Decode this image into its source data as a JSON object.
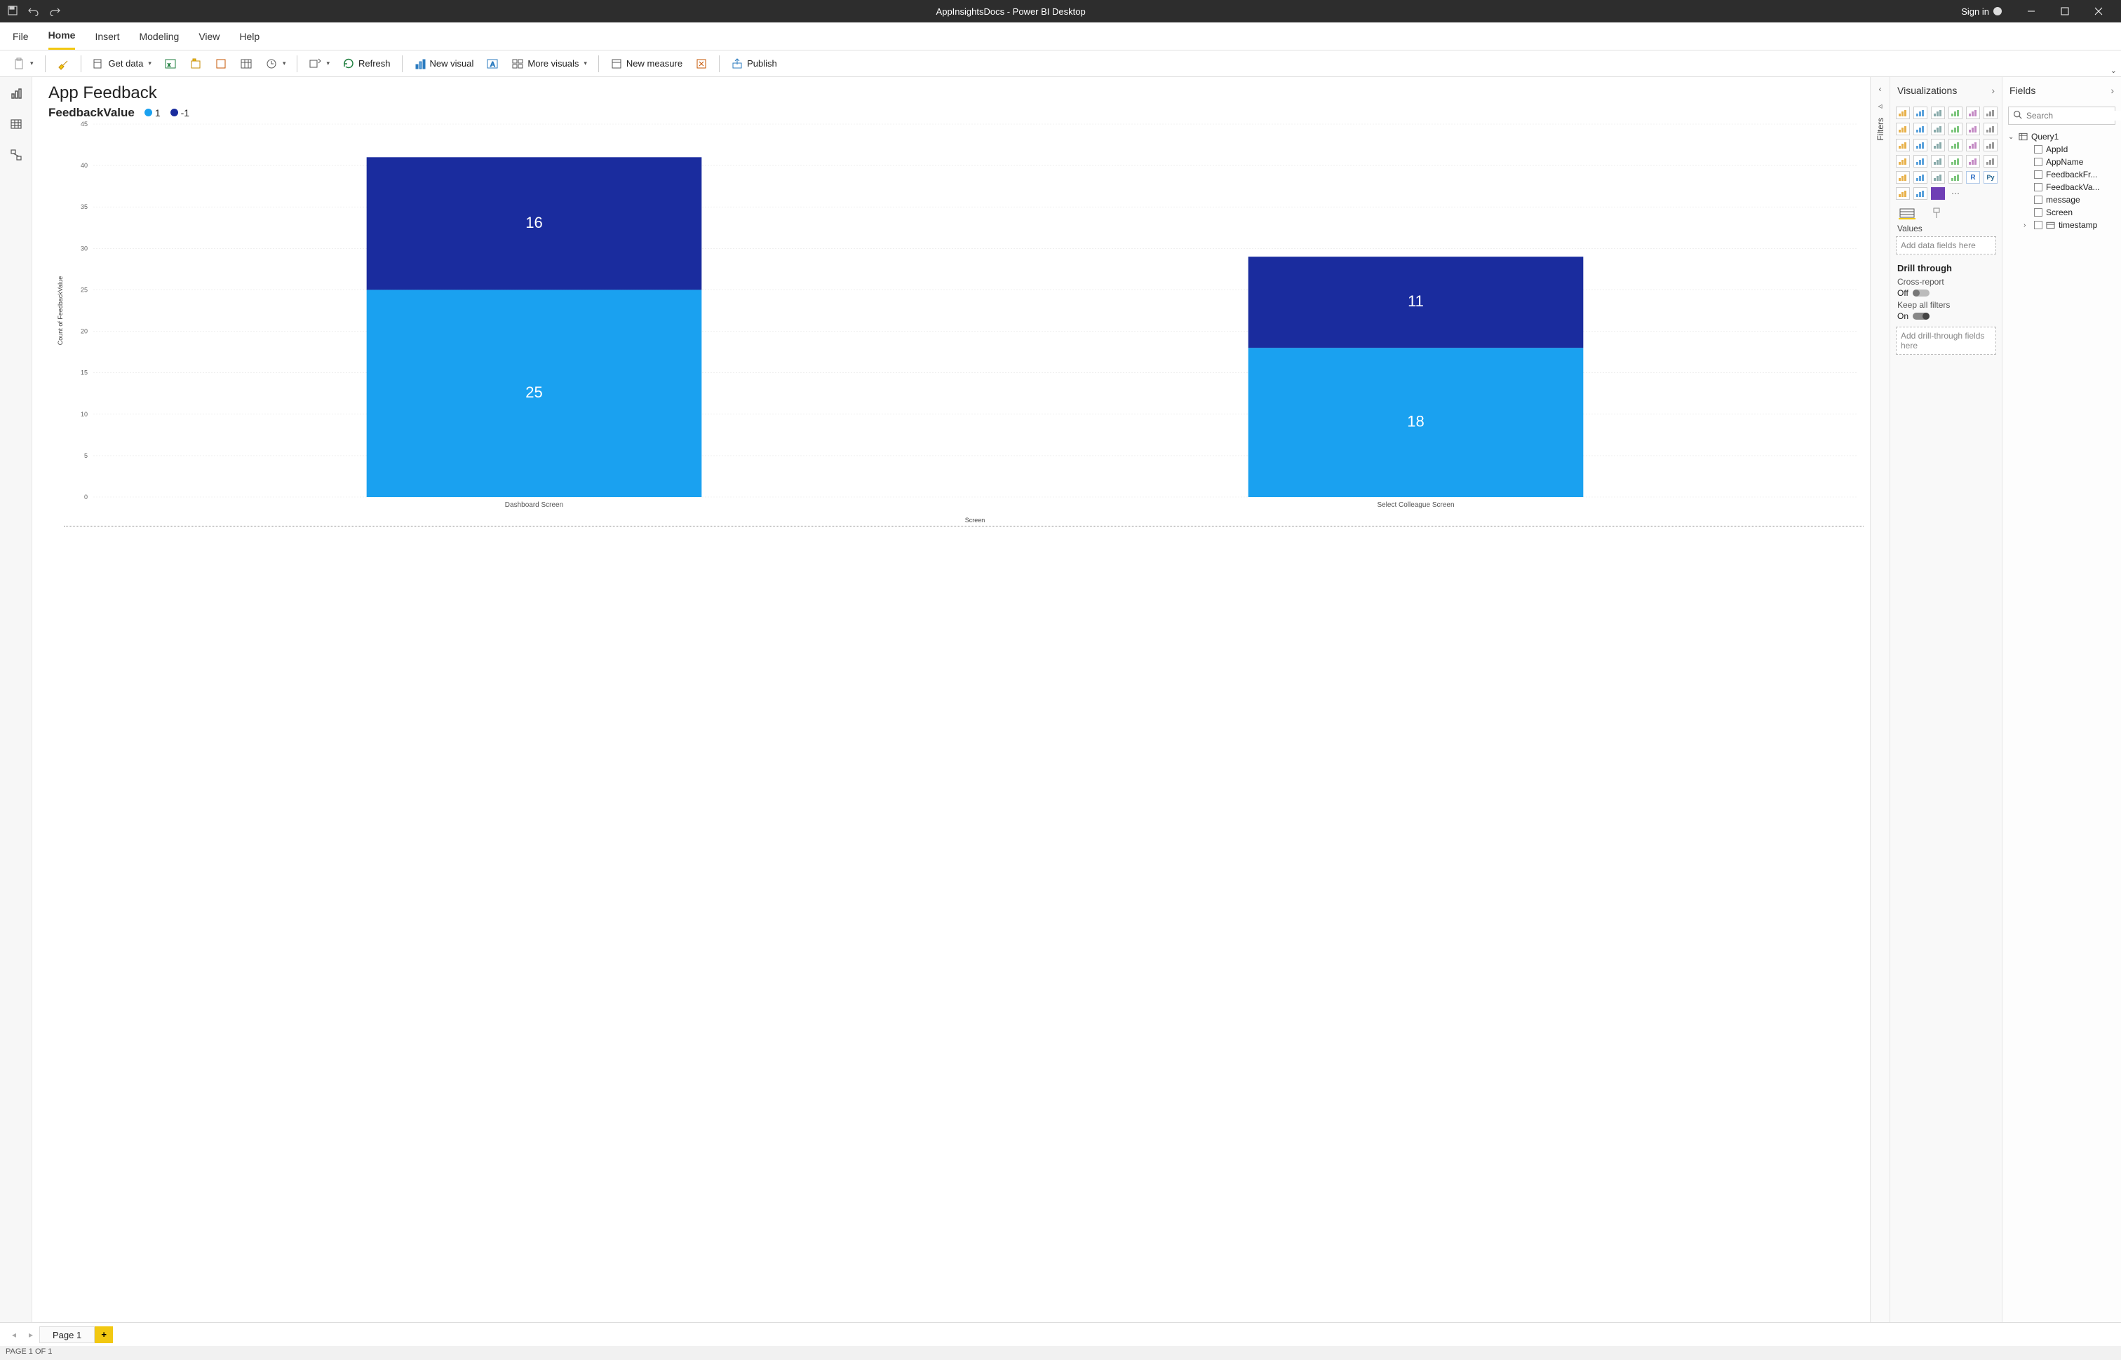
{
  "titlebar": {
    "title": "AppInsightsDocs - Power BI Desktop",
    "sign_in": "Sign in"
  },
  "menu_tabs": [
    "File",
    "Home",
    "Insert",
    "Modeling",
    "View",
    "Help"
  ],
  "menu_active": "Home",
  "ribbon": {
    "get_data": "Get data",
    "refresh": "Refresh",
    "new_visual": "New visual",
    "more_visuals": "More visuals",
    "new_measure": "New measure",
    "publish": "Publish",
    "textbox": "A"
  },
  "report": {
    "title": "App Feedback",
    "legend_series": "FeedbackValue",
    "legend_items": [
      {
        "label": "1",
        "color": "#1aa1f0"
      },
      {
        "label": "-1",
        "color": "#1a2c9e"
      }
    ],
    "y_axis_title": "Count of FeedbackValue",
    "x_axis_title": "Screen"
  },
  "chart_data": {
    "type": "bar",
    "stacked": true,
    "categories": [
      "Dashboard Screen",
      "Select Colleague Screen"
    ],
    "series": [
      {
        "name": "1",
        "color": "#1aa1f0",
        "values": [
          25,
          18
        ]
      },
      {
        "name": "-1",
        "color": "#1a2c9e",
        "values": [
          16,
          11
        ]
      }
    ],
    "xlabel": "Screen",
    "ylabel": "Count of FeedbackValue",
    "ylim": [
      0,
      45
    ],
    "yticks": [
      0,
      5,
      10,
      15,
      20,
      25,
      30,
      35,
      40,
      45
    ]
  },
  "filters": {
    "label": "Filters"
  },
  "viz_pane": {
    "title": "Visualizations",
    "values_label": "Values",
    "values_placeholder": "Add data fields here",
    "drill_header": "Drill through",
    "cross_report": "Cross-report",
    "cross_report_state": "Off",
    "keep_filters": "Keep all filters",
    "keep_filters_state": "On",
    "drill_placeholder": "Add drill-through fields here"
  },
  "fields_pane": {
    "title": "Fields",
    "search_placeholder": "Search",
    "table": "Query1",
    "columns": [
      "AppId",
      "AppName",
      "FeedbackFr...",
      "FeedbackVa...",
      "message",
      "Screen"
    ],
    "groups": [
      "timestamp"
    ]
  },
  "page_tabs": {
    "page1": "Page 1"
  },
  "statusbar": {
    "text": "PAGE 1 OF 1"
  }
}
